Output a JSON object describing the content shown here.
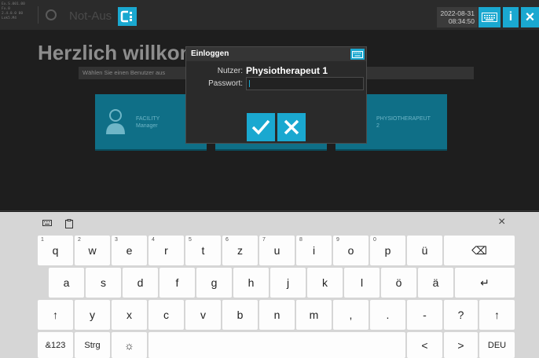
{
  "topbar": {
    "version_lines": [
      "Ex.S.001.00",
      "Fx.0",
      "2.4.0.0 00",
      "Lok5.M4"
    ],
    "notaus_label": "Not-Aus",
    "logo_text": "C",
    "date": "2022-08-31",
    "time": "08:34:50",
    "info_label": "i",
    "close_label": "×",
    "accent": "#1aa8d0"
  },
  "main": {
    "welcome": "Herzlich willkom",
    "user_select_hint": "Wählen Sie einen Benutzer aus",
    "tiles": [
      {
        "line1": "FACILITY",
        "line2": "Manager"
      },
      {
        "line1": "PHYSIOTHERAPEUT",
        "line2": "2"
      }
    ]
  },
  "dialog": {
    "title": "Einloggen",
    "user_label": "Nutzer:",
    "user_value": "Physiotherapeut 1",
    "password_label": "Passwort:",
    "password_value": ""
  },
  "keyboard": {
    "close_label": "×",
    "row1": [
      {
        "label": "q",
        "num": "1"
      },
      {
        "label": "w",
        "num": "2"
      },
      {
        "label": "e",
        "num": "3"
      },
      {
        "label": "r",
        "num": "4"
      },
      {
        "label": "t",
        "num": "5"
      },
      {
        "label": "z",
        "num": "6"
      },
      {
        "label": "u",
        "num": "7"
      },
      {
        "label": "i",
        "num": "8"
      },
      {
        "label": "o",
        "num": "9"
      },
      {
        "label": "p",
        "num": "0"
      },
      {
        "label": "ü",
        "num": ""
      },
      {
        "label": "⌫",
        "num": ""
      }
    ],
    "row2": [
      "a",
      "s",
      "d",
      "f",
      "g",
      "h",
      "j",
      "k",
      "l",
      "ö",
      "ä",
      "↵"
    ],
    "row3": [
      "↑",
      "y",
      "x",
      "c",
      "v",
      "b",
      "n",
      "m",
      ",",
      ".",
      "-",
      "?",
      "↑"
    ],
    "row4": [
      "&123",
      "Strg",
      "☼",
      "",
      "<",
      ">",
      "DEU"
    ]
  }
}
